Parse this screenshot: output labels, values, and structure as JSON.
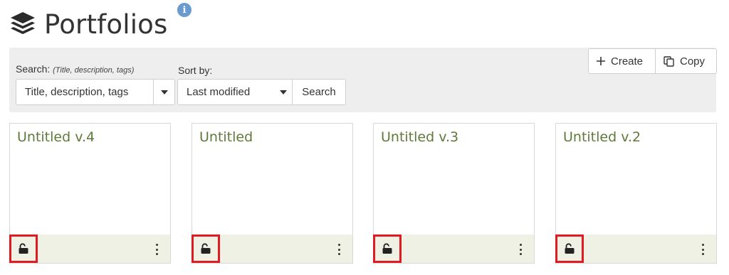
{
  "header": {
    "title": "Portfolios",
    "icon": "layers-icon",
    "info_icon": "info-icon",
    "info_glyph": "i",
    "info_color": "#6a9bd0"
  },
  "toolbar": {
    "search_label": "Search:",
    "search_hint": "(Title, description, tags)",
    "search_select_value": "Title, description, tags",
    "sort_label": "Sort by:",
    "sort_select_value": "Last modified",
    "search_button": "Search",
    "create_button": "Create",
    "copy_button": "Copy"
  },
  "cards": [
    {
      "title": "Untitled v.4",
      "lock_icon": "unlock-icon",
      "menu_icon": "more-vertical-icon"
    },
    {
      "title": "Untitled",
      "lock_icon": "unlock-icon",
      "menu_icon": "more-vertical-icon"
    },
    {
      "title": "Untitled v.3",
      "lock_icon": "unlock-icon",
      "menu_icon": "more-vertical-icon"
    },
    {
      "title": "Untitled v.2",
      "lock_icon": "unlock-icon",
      "menu_icon": "more-vertical-icon"
    }
  ],
  "colors": {
    "card_title": "#5f7a38",
    "card_footer": "#eef1e4",
    "highlight": "#e01b22",
    "toolbar_bg": "#eeeeee"
  }
}
